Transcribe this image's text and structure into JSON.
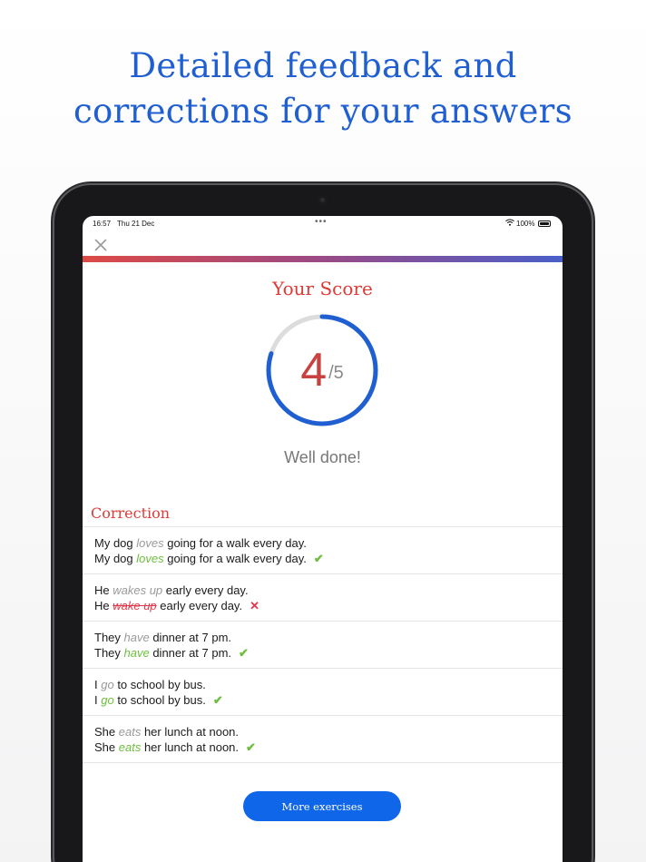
{
  "headline": {
    "line1": "Detailed feedback and",
    "line2": "corrections for your answers"
  },
  "status_bar": {
    "time": "16:57",
    "date": "Thu 21 Dec",
    "battery_text": "100%"
  },
  "score": {
    "title": "Your Score",
    "correct": "4",
    "total": "/5",
    "fraction": 0.8,
    "feedback": "Well done!"
  },
  "correction": {
    "title": "Correction",
    "items": [
      {
        "q_pre": "My dog ",
        "q_ans": "loves",
        "q_post": " going for a walk every day.",
        "a_pre": "My dog ",
        "a_ans": "loves",
        "a_post": " going for a walk every day.",
        "mark": "✔"
      },
      {
        "q_pre": "He ",
        "q_ans": "wakes up",
        "q_post": " early every day.",
        "a_pre": "He ",
        "a_ans": "wake up",
        "a_post": " early every day.",
        "mark": "✕"
      },
      {
        "q_pre": "They ",
        "q_ans": "have",
        "q_post": " dinner at 7 pm.",
        "a_pre": "They ",
        "a_ans": "have",
        "a_post": " dinner at 7 pm.",
        "mark": "✔"
      },
      {
        "q_pre": "I ",
        "q_ans": "go",
        "q_post": " to school by bus.",
        "a_pre": "I ",
        "a_ans": "go",
        "a_post": " to school by bus.",
        "mark": "✔"
      },
      {
        "q_pre": "She ",
        "q_ans": "eats",
        "q_post": " her lunch at noon.",
        "a_pre": "She ",
        "a_ans": "eats",
        "a_post": " her lunch at noon.",
        "mark": "✔"
      }
    ]
  },
  "more_button": {
    "label": "More exercises"
  },
  "colors": {
    "headline": "#1f5fd1",
    "accent_red": "#dc3b37",
    "correct_green": "#6dbf3e",
    "wrong_red": "#e2374a",
    "button_blue": "#0f66e8",
    "ring_blue": "#1f5fd1",
    "ring_gray": "#dcdcdc"
  },
  "icons": {
    "close": "close-icon",
    "wifi": "wifi-icon",
    "battery": "battery-icon",
    "check": "check-icon",
    "cross": "cross-icon"
  }
}
